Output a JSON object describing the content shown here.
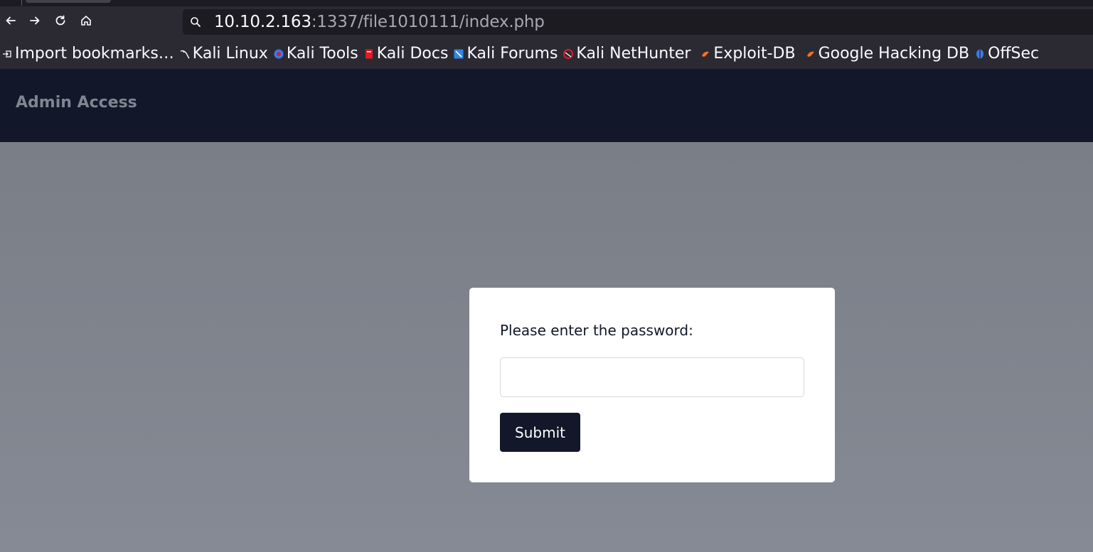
{
  "browser": {
    "url_host": "10.10.2.163",
    "url_rest": ":1337/file1010111/index.php",
    "nav": {
      "back_icon": "arrow-left-icon",
      "forward_icon": "arrow-right-icon",
      "reload_icon": "reload-icon",
      "home_icon": "home-icon"
    },
    "bookmarks": [
      {
        "label": "Import bookmarks…",
        "icon": "import-icon",
        "color": "#fbfbfe"
      },
      {
        "label": "Kali Linux",
        "icon": "kali-dragon-icon",
        "color": "#ffffff"
      },
      {
        "label": "Kali Tools",
        "icon": "kali-tools-icon",
        "color": "#367bf0"
      },
      {
        "label": "Kali Docs",
        "icon": "kali-docs-icon",
        "color": "#e01b24"
      },
      {
        "label": "Kali Forums",
        "icon": "kali-forums-icon",
        "color": "#3584e4"
      },
      {
        "label": "Kali NetHunter",
        "icon": "nethunter-icon",
        "color": "#e01b24"
      },
      {
        "label": "Exploit-DB",
        "icon": "exploit-db-icon",
        "color": "#f66f1f"
      },
      {
        "label": "Google Hacking DB",
        "icon": "ghdb-icon",
        "color": "#f66f1f"
      },
      {
        "label": "OffSec",
        "icon": "offsec-icon",
        "color": "#3d7be8"
      }
    ]
  },
  "page": {
    "header_title": "Admin Access",
    "form": {
      "prompt": "Please enter the password:",
      "password_value": "",
      "submit_label": "Submit"
    }
  }
}
